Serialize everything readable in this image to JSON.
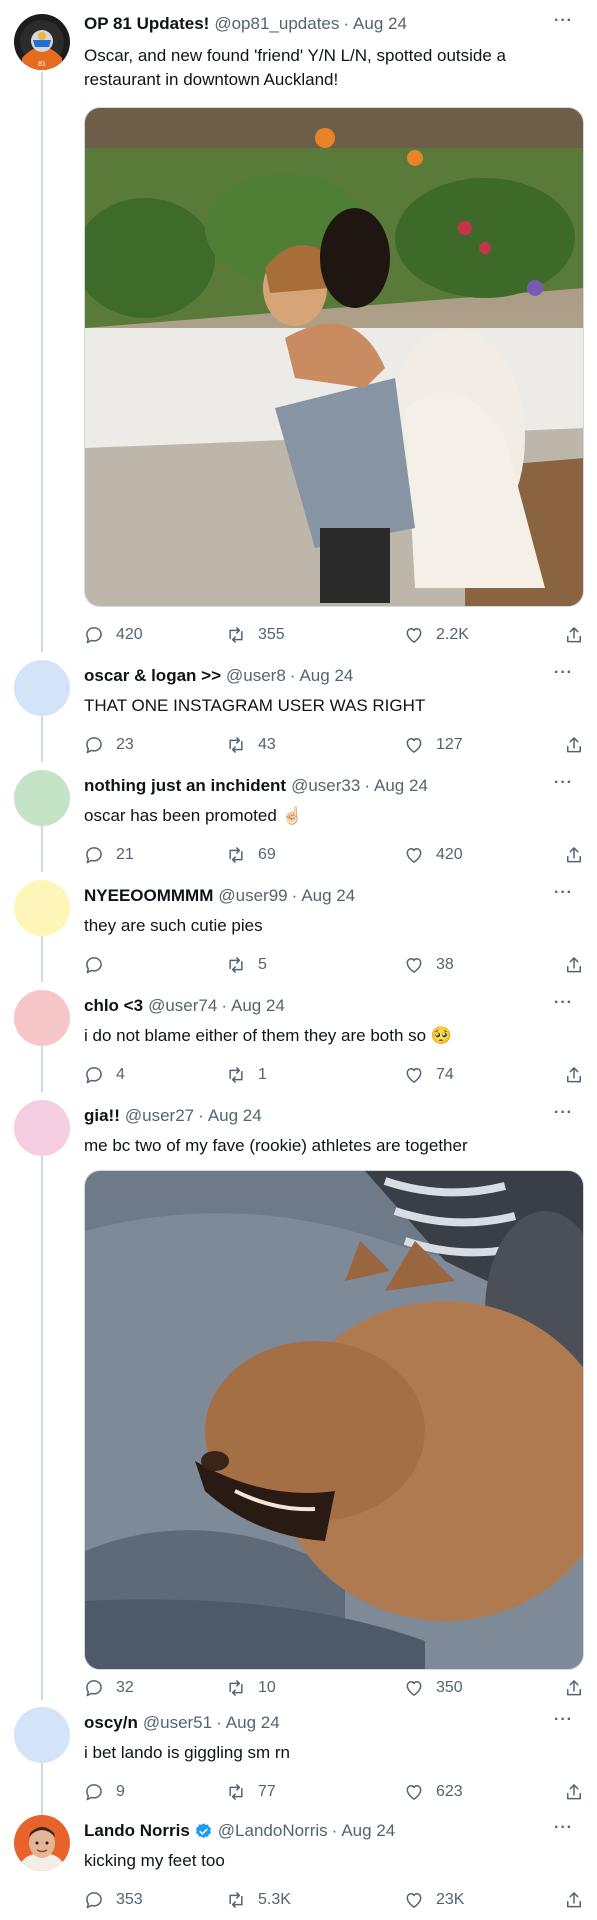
{
  "tweets": [
    {
      "name": "OP 81 Updates!",
      "handle": "@op81_updates",
      "sep": "·",
      "date": "Aug 24",
      "text": "Oscar, and new found 'friend' Y/N L/N, spotted outside a restaurant in downtown Auckland!",
      "replies": "420",
      "retweets": "355",
      "likes": "2.2K",
      "avatar_color": "#1a1a1a",
      "media": "photo-couple-embracing"
    },
    {
      "name": "oscar & logan >>",
      "handle": "@user8",
      "sep": "·",
      "date": "Aug 24",
      "text": "THAT ONE INSTAGRAM USER WAS RIGHT",
      "replies": "23",
      "retweets": "43",
      "likes": "127",
      "avatar_color": "#d3e3f8"
    },
    {
      "name": "nothing just an inchident",
      "handle": "@user33",
      "sep": "·",
      "date": "Aug 24",
      "text": "oscar has been promoted ☝🏻",
      "replies": "21",
      "retweets": "69",
      "likes": "420",
      "avatar_color": "#c4e3c7"
    },
    {
      "name": "NYEEOOMMMM",
      "handle": "@user99",
      "sep": "·",
      "date": "Aug 24",
      "text": "they are such cutie pies",
      "replies": "",
      "retweets": "5",
      "likes": "38",
      "avatar_color": "#fdf6b8"
    },
    {
      "name": "chlo <3",
      "handle": "@user74",
      "sep": "·",
      "date": "Aug 24",
      "text": "i do not blame either of them they are both so 🥺",
      "replies": "4",
      "retweets": "1",
      "likes": "74",
      "avatar_color": "#f7c6c8"
    },
    {
      "name": "gia!!",
      "handle": "@user27",
      "sep": "·",
      "date": "Aug 24",
      "text": "me bc two of my fave (rookie) athletes are together",
      "replies": "32",
      "retweets": "10",
      "likes": "350",
      "avatar_color": "#f5cde0",
      "media": "gif-yawning-dog"
    },
    {
      "name": "oscy/n",
      "handle": "@user51",
      "sep": "·",
      "date": "Aug 24",
      "text": "i bet lando is giggling sm rn",
      "replies": "9",
      "retweets": "77",
      "likes": "623",
      "avatar_color": "#d3e3f8"
    },
    {
      "name": "Lando Norris",
      "handle": "@LandoNorris",
      "sep": "·",
      "date": "Aug 24",
      "text": "kicking my feet too",
      "replies": "353",
      "retweets": "5.3K",
      "likes": "23K",
      "avatar_color": "#e8622c",
      "verified": true
    }
  ],
  "icons": {
    "reply": "reply-icon",
    "retweet": "retweet-icon",
    "like": "heart-icon",
    "share": "share-icon",
    "more": "more-icon",
    "verified": "verified-badge-icon"
  },
  "colors": {
    "text_primary": "#0f1419",
    "text_secondary": "#536471",
    "thread_line": "#cfd9de",
    "verified_blue": "#1d9bf0"
  },
  "more_glyph": "···"
}
